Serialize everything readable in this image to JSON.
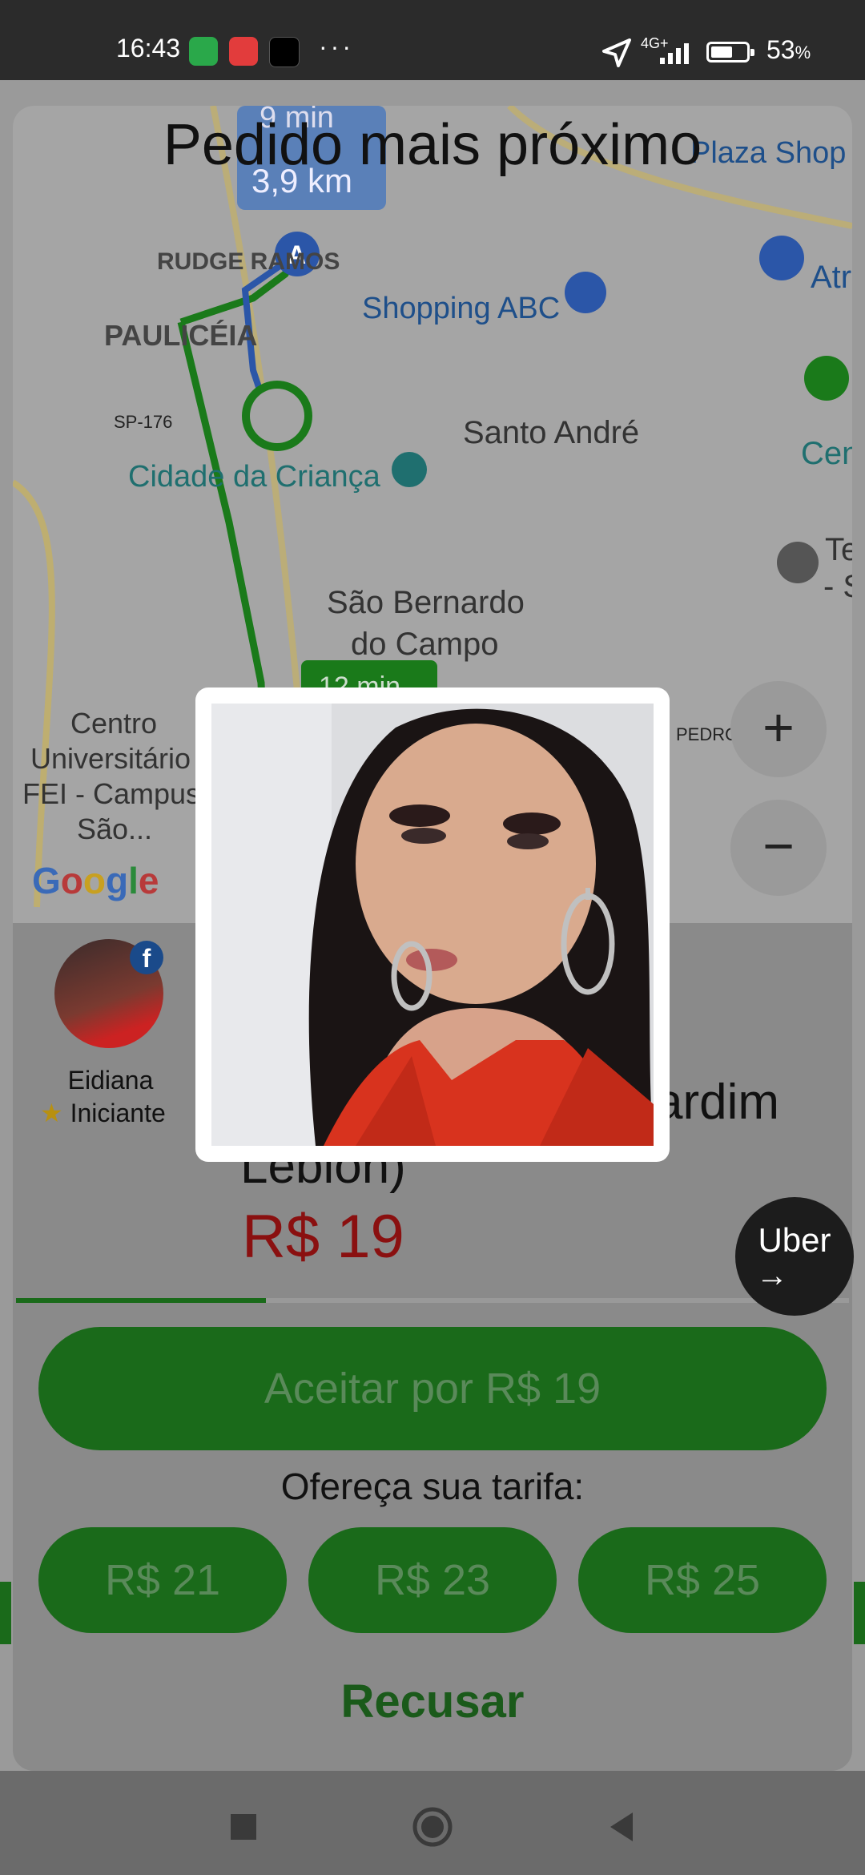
{
  "status_bar": {
    "time": "16:43",
    "network": "4G+",
    "battery_percent": "53",
    "battery_symbol": "%",
    "more": "···"
  },
  "map": {
    "labels": {
      "rudge_ramos": "RUDGE RAMOS",
      "pauliceia": "PAULICÉIA",
      "shopping_abc": "Shopping ABC",
      "santo_andre": "Santo André",
      "sp176": "SP-176",
      "cidade_crianca": "Cidade da Criança",
      "sao_bernardo_1": "São Bernardo",
      "sao_bernardo_2": "do Campo",
      "centro_1": "Centro",
      "centro_2": "Universitário",
      "centro_3": "FEI - Campus",
      "centro_4": "São...",
      "plaza_shop": "Plaza Shop",
      "atr": "Atr",
      "cen": "Cen",
      "te": "Te",
      "s_dash": "- S",
      "pedro": "PEDRO",
      "route_time_top": "9 min",
      "route_dist": "3,9 km",
      "route_time_bottom": "12 min",
      "marker_a": "A"
    },
    "google": "Google",
    "zoom_in": "+",
    "zoom_out": "−"
  },
  "title": "Pedido mais próximo",
  "rider": {
    "name": "Eidiana",
    "rank": "Iniciante",
    "star": "★",
    "fb": "f"
  },
  "destination": {
    "line1": "ardim",
    "line2": "Lebion)"
  },
  "price": "R$ 19",
  "accept_label": "Aceitar por R$ 19",
  "offer_label": "Ofereça sua tarifa:",
  "fare_options": [
    "R$ 21",
    "R$ 23",
    "R$ 25"
  ],
  "refuse_label": "Recusar",
  "uber_fab": {
    "line1": "Uber",
    "arrow": "→"
  },
  "progress": 0.3
}
